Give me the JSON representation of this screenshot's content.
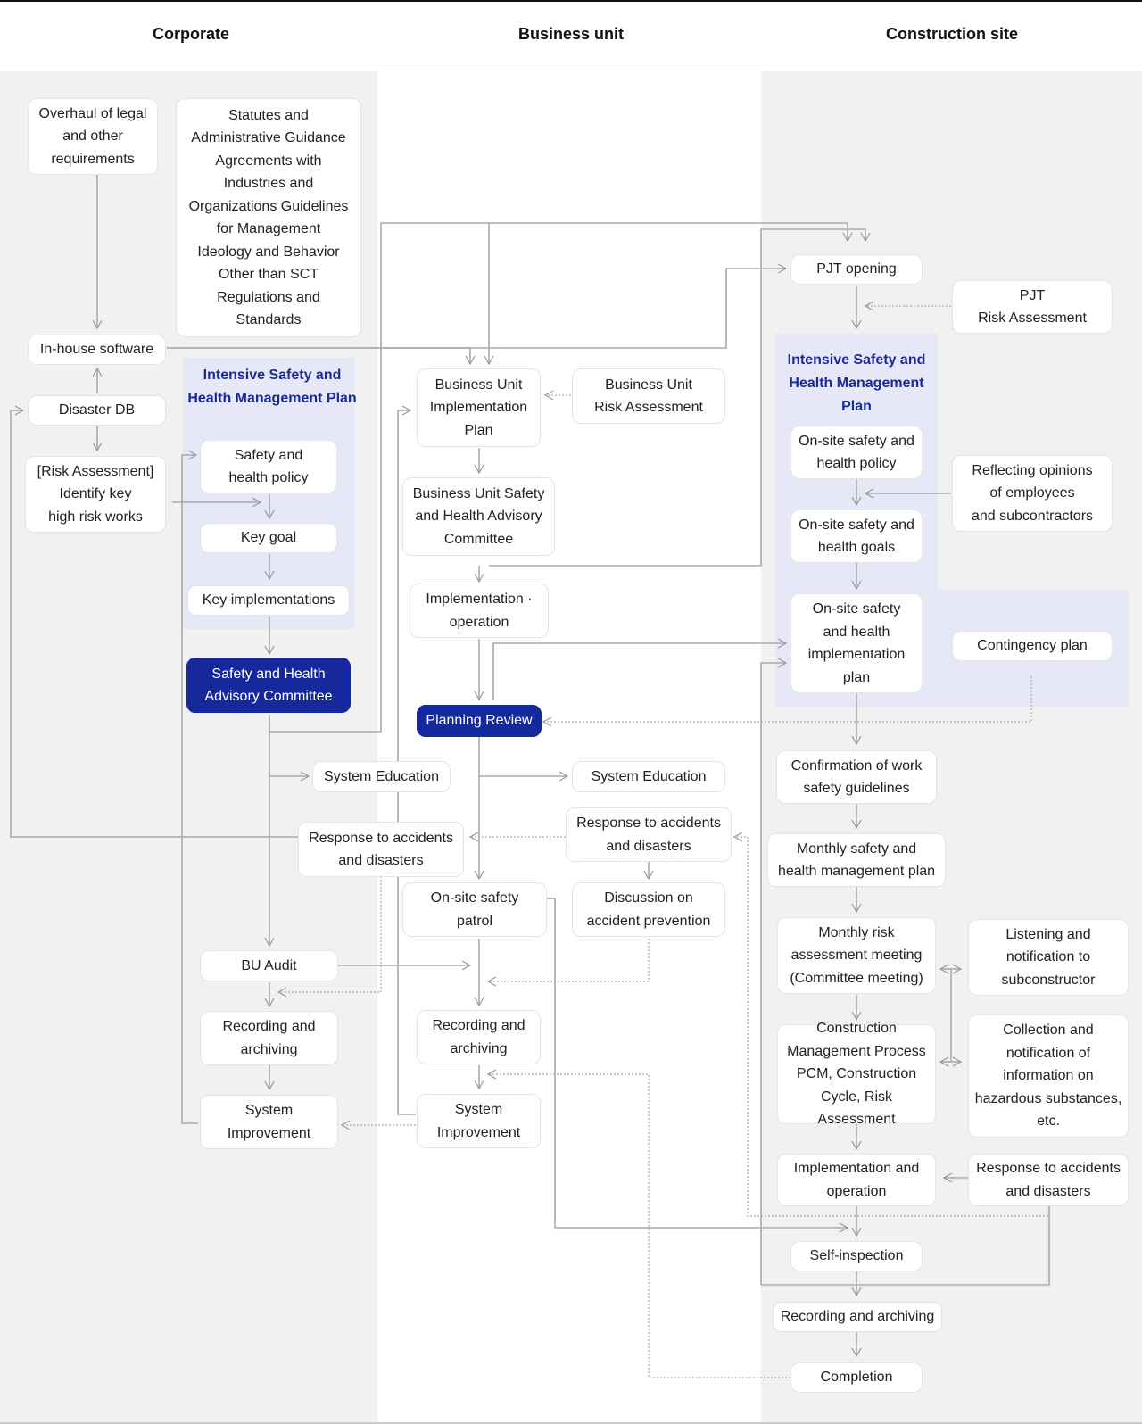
{
  "header": {
    "columns": [
      "Corporate",
      "Business unit",
      "Construction site"
    ]
  },
  "corporate": {
    "overhaul": "Overhaul of legal\nand other\nrequirements",
    "statutes": "Statutes and\nAdministrative Guidance\nAgreements with\nIndustries and\nOrganizations Guidelines\nfor Management\nIdeology and Behavior\nOther than SCT\nRegulations and\nStandards",
    "inhouse": "In-house software",
    "disaster_db": "Disaster DB",
    "risk_assessment": "[Risk Assessment]\nIdentify key\nhigh risk works",
    "group_title": "Intensive Safety and\nHealth Management\nPlan",
    "policy": "Safety and\nhealth policy",
    "key_goal": "Key goal",
    "key_impl": "Key implementations",
    "committee": "Safety and Health\nAdvisory Committee",
    "system_education": "System Education",
    "response": "Response to accidents\nand disasters",
    "bu_audit": "BU Audit",
    "recording": "Recording and\narchiving",
    "system_improvement": "System\nImprovement"
  },
  "business_unit": {
    "impl_plan": "Business Unit\nImplementation\nPlan",
    "risk_assessment": "Business Unit\nRisk Assessment",
    "advisory": "Business Unit Safety\nand Health Advisory\nCommittee",
    "impl_operation": "Implementation ·\noperation",
    "planning_review": "Planning Review",
    "system_education": "System Education",
    "response": "Response to accidents\nand disasters",
    "patrol": "On-site safety\npatrol",
    "discussion": "Discussion on\naccident prevention",
    "recording": "Recording and\narchiving",
    "system_improvement": "System\nImprovement"
  },
  "site": {
    "pjt_opening": "PJT opening",
    "pjt_risk": "PJT\nRisk Assessment",
    "group_title": "Intensive Safety and\nHealth Management\nPlan",
    "policy": "On-site safety and\nhealth policy",
    "reflecting": "Reflecting opinions\nof employees\nand subcontractors",
    "goals": "On-site safety and\nhealth goals",
    "impl_plan": "On-site safety\nand health\nimplementation\nplan",
    "contingency": "Contingency plan",
    "confirmation": "Confirmation of work\nsafety guidelines",
    "monthly_plan": "Monthly safety and\nhealth management plan",
    "monthly_risk": "Monthly risk\nassessment meeting\n(Committee meeting)",
    "listening": "Listening and\nnotification to\nsubconstructor",
    "construction_mgmt": "Construction\nManagement Process\nPCM, Construction\nCycle, Risk Assessment",
    "collection": "Collection and\nnotification of\ninformation on\nhazardous substances,\netc.",
    "impl_operation": "Implementation and\noperation",
    "response": "Response to accidents\nand disasters",
    "self_inspection": "Self-inspection",
    "recording": "Recording and archiving",
    "completion": "Completion"
  },
  "colors": {
    "accent": "#15289c",
    "group_bg": "#e6e8f8",
    "lane_grey": "#f1f1f1",
    "connector": "#aaaaaa"
  }
}
